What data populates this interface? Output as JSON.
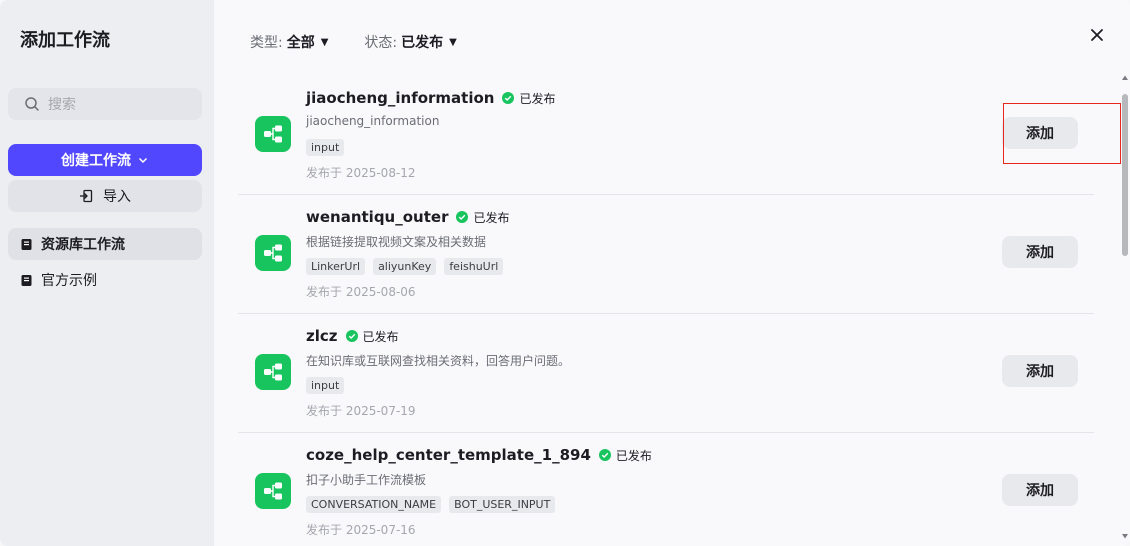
{
  "sidebar": {
    "title": "添加工作流",
    "search_placeholder": "搜索",
    "create_label": "创建工作流",
    "import_label": "导入",
    "nav": [
      {
        "label": "资源库工作流",
        "active": true
      },
      {
        "label": "官方示例",
        "active": false
      }
    ]
  },
  "filters": {
    "type_label": "类型:",
    "type_value": "全部",
    "status_label": "状态:",
    "status_value": "已发布"
  },
  "workflows": [
    {
      "name": "jiaocheng_information",
      "status": "已发布",
      "desc": "jiaocheng_information",
      "tags": [
        "input"
      ],
      "date": "发布于 2025-08-12",
      "add_label": "添加"
    },
    {
      "name": "wenantiqu_outer",
      "status": "已发布",
      "desc": "根据链接提取视频文案及相关数据",
      "tags": [
        "LinkerUrl",
        "aliyunKey",
        "feishuUrl"
      ],
      "date": "发布于 2025-08-06",
      "add_label": "添加"
    },
    {
      "name": "zlcz",
      "status": "已发布",
      "desc": "在知识库或互联网查找相关资料，回答用户问题。",
      "tags": [
        "input"
      ],
      "date": "发布于 2025-07-19",
      "add_label": "添加"
    },
    {
      "name": "coze_help_center_template_1_894",
      "status": "已发布",
      "desc": "扣子小助手工作流模板",
      "tags": [
        "CONVERSATION_NAME",
        "BOT_USER_INPUT"
      ],
      "date": "发布于 2025-07-16",
      "add_label": "添加"
    }
  ],
  "colors": {
    "accent": "#5147ff",
    "workflow_icon": "#18c45e",
    "status_ok": "#18c45e",
    "highlight": "#e5271d"
  },
  "icons": {
    "search": "search-icon",
    "close": "close-icon",
    "workflow": "workflow-icon",
    "published": "check-circle-icon"
  }
}
